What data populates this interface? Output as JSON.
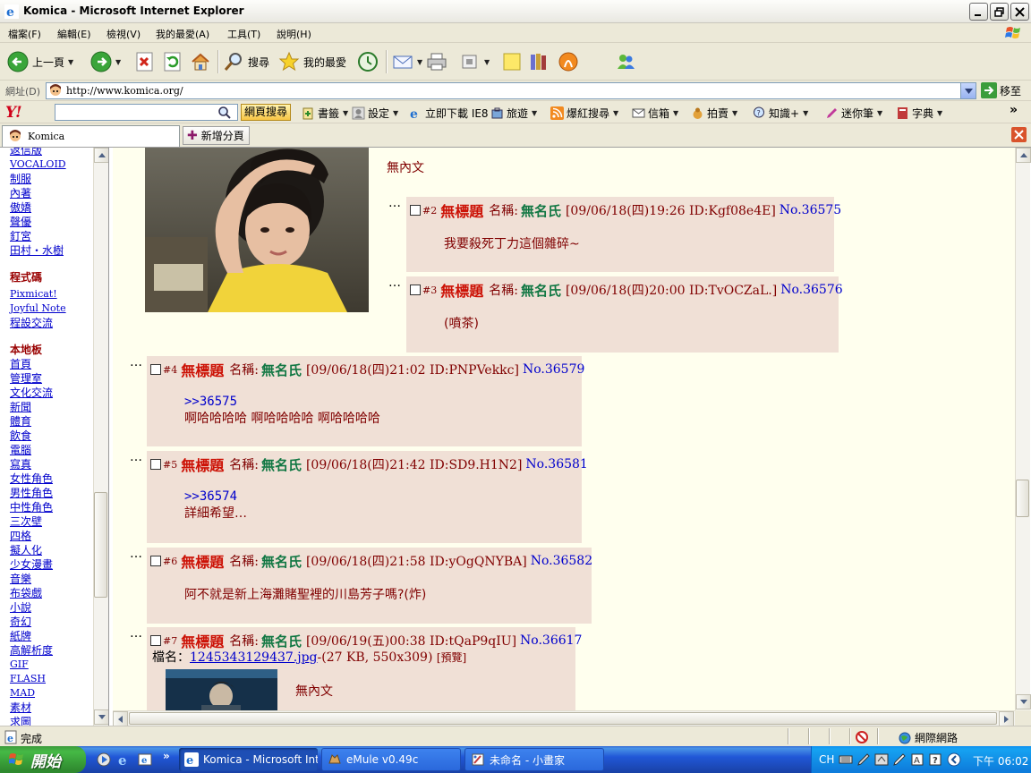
{
  "window": {
    "title": "Komica - Microsoft Internet Explorer"
  },
  "menu": [
    "檔案(F)",
    "編輯(E)",
    "檢視(V)",
    "我的最愛(A)",
    "工具(T)",
    "說明(H)"
  ],
  "toolbar": {
    "back": "上一頁",
    "search": "搜尋",
    "favorites": "我的最愛"
  },
  "address": {
    "label": "網址(D)",
    "url": "http://www.komica.org/",
    "go": "移至"
  },
  "yahoo": {
    "logo": "Y!",
    "search_button": "網頁搜尋",
    "items": [
      "書籤",
      "設定",
      "立即下載 IE8",
      "旅遊",
      "爆紅搜尋",
      "信箱",
      "拍賣",
      "知識+",
      "迷你筆",
      "字典"
    ]
  },
  "tabs": {
    "active": "Komica",
    "new_tab": "新增分頁"
  },
  "sidebar": {
    "groups": [
      {
        "header": "",
        "links": [
          "返信版",
          "VOCALOID",
          "制服",
          "內著",
          "傲嬌",
          "聲優",
          "釘宮",
          "田村・水樹"
        ]
      },
      {
        "header": "程式碼",
        "links": [
          "Pixmicat!",
          "Joyful Note",
          "程設交流"
        ]
      },
      {
        "header": "本地板",
        "links": [
          "首頁",
          "管理室",
          "文化交流",
          "新聞",
          "體育",
          "飲食",
          "電腦",
          "寫真",
          "女性角色",
          "男性角色",
          "中性角色",
          "三次壁",
          "四格",
          "擬人化",
          "少女漫畫",
          "音樂",
          "布袋戲",
          "小說",
          "奇幻",
          "紙牌",
          "高解析度",
          "GIF",
          "FLASH",
          "MAD",
          "素材",
          "求圖"
        ]
      }
    ]
  },
  "thread": {
    "op_body": "無內文",
    "dots": "…",
    "name_label": "名稱:",
    "replies": [
      {
        "no": "#2",
        "title": "無標題",
        "name": "無名氏",
        "meta": "[09/06/18(四)19:26 ID:Kgf08e4E]",
        "post": "No.36575",
        "quote": "",
        "text": "我要殺死丁力這個雜碎~"
      },
      {
        "no": "#3",
        "title": "無標題",
        "name": "無名氏",
        "meta": "[09/06/18(四)20:00 ID:TvOCZaL.]",
        "post": "No.36576",
        "quote": "",
        "text": "(噴茶)"
      },
      {
        "no": "#4",
        "title": "無標題",
        "name": "無名氏",
        "meta": "[09/06/18(四)21:02 ID:PNPVekkc]",
        "post": "No.36579",
        "quote": ">>36575",
        "text": "啊哈哈哈哈 啊哈哈哈哈 啊哈哈哈哈"
      },
      {
        "no": "#5",
        "title": "無標題",
        "name": "無名氏",
        "meta": "[09/06/18(四)21:42 ID:SD9.H1N2]",
        "post": "No.36581",
        "quote": ">>36574",
        "text": "詳細希望…"
      },
      {
        "no": "#6",
        "title": "無標題",
        "name": "無名氏",
        "meta": "[09/06/18(四)21:58 ID:yOgQNYBA]",
        "post": "No.36582",
        "quote": "",
        "text": "阿不就是新上海灘賭聖裡的川島芳子嗎?(炸)"
      },
      {
        "no": "#7",
        "title": "無標題",
        "name": "無名氏",
        "meta": "[09/06/19(五)00:38 ID:tQaP9qIU]",
        "post": "No.36617",
        "quote": "",
        "text": "無內文",
        "file_label": "檔名：",
        "file_name": "1245343129437.jpg",
        "file_info": "-(27 KB, 550x309)",
        "preview": "[預覽]"
      }
    ]
  },
  "status": {
    "text": "完成",
    "zone": "網際網路"
  },
  "taskbar": {
    "start": "開始",
    "tasks": [
      "Komica - Microsoft Int...",
      "eMule v0.49c",
      "未命名 - 小畫家"
    ],
    "lang": "CH",
    "clock": "下午 06:02"
  },
  "colors": {
    "board_bg": "#ffffee",
    "reply_bg": "#f0e0d6",
    "title_red": "#cc1105",
    "name_green": "#117743",
    "link_blue": "#0000cc"
  }
}
